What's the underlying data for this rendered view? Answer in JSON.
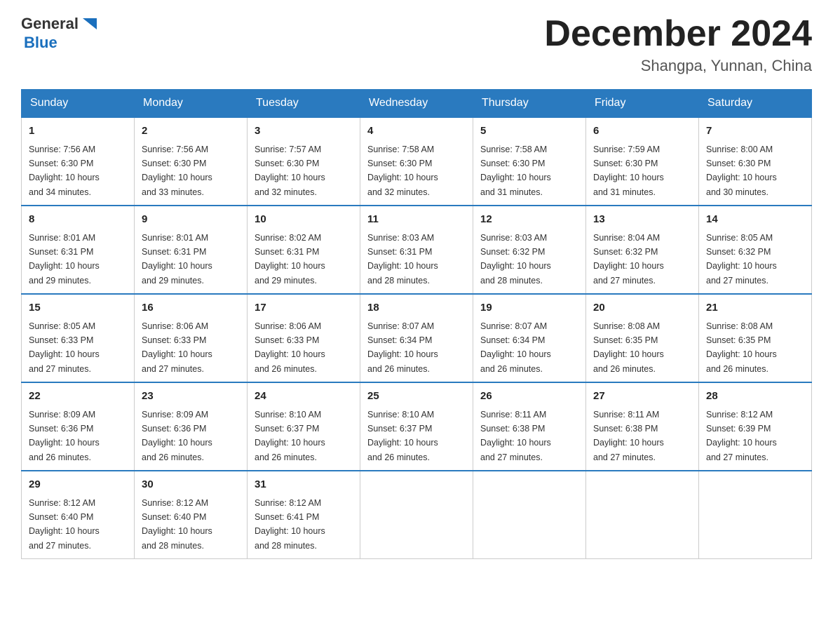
{
  "header": {
    "logo_general": "General",
    "logo_blue": "Blue",
    "title": "December 2024",
    "location": "Shangpa, Yunnan, China"
  },
  "columns": [
    "Sunday",
    "Monday",
    "Tuesday",
    "Wednesday",
    "Thursday",
    "Friday",
    "Saturday"
  ],
  "weeks": [
    [
      {
        "day": "1",
        "info": "Sunrise: 7:56 AM\nSunset: 6:30 PM\nDaylight: 10 hours\nand 34 minutes."
      },
      {
        "day": "2",
        "info": "Sunrise: 7:56 AM\nSunset: 6:30 PM\nDaylight: 10 hours\nand 33 minutes."
      },
      {
        "day": "3",
        "info": "Sunrise: 7:57 AM\nSunset: 6:30 PM\nDaylight: 10 hours\nand 32 minutes."
      },
      {
        "day": "4",
        "info": "Sunrise: 7:58 AM\nSunset: 6:30 PM\nDaylight: 10 hours\nand 32 minutes."
      },
      {
        "day": "5",
        "info": "Sunrise: 7:58 AM\nSunset: 6:30 PM\nDaylight: 10 hours\nand 31 minutes."
      },
      {
        "day": "6",
        "info": "Sunrise: 7:59 AM\nSunset: 6:30 PM\nDaylight: 10 hours\nand 31 minutes."
      },
      {
        "day": "7",
        "info": "Sunrise: 8:00 AM\nSunset: 6:30 PM\nDaylight: 10 hours\nand 30 minutes."
      }
    ],
    [
      {
        "day": "8",
        "info": "Sunrise: 8:01 AM\nSunset: 6:31 PM\nDaylight: 10 hours\nand 29 minutes."
      },
      {
        "day": "9",
        "info": "Sunrise: 8:01 AM\nSunset: 6:31 PM\nDaylight: 10 hours\nand 29 minutes."
      },
      {
        "day": "10",
        "info": "Sunrise: 8:02 AM\nSunset: 6:31 PM\nDaylight: 10 hours\nand 29 minutes."
      },
      {
        "day": "11",
        "info": "Sunrise: 8:03 AM\nSunset: 6:31 PM\nDaylight: 10 hours\nand 28 minutes."
      },
      {
        "day": "12",
        "info": "Sunrise: 8:03 AM\nSunset: 6:32 PM\nDaylight: 10 hours\nand 28 minutes."
      },
      {
        "day": "13",
        "info": "Sunrise: 8:04 AM\nSunset: 6:32 PM\nDaylight: 10 hours\nand 27 minutes."
      },
      {
        "day": "14",
        "info": "Sunrise: 8:05 AM\nSunset: 6:32 PM\nDaylight: 10 hours\nand 27 minutes."
      }
    ],
    [
      {
        "day": "15",
        "info": "Sunrise: 8:05 AM\nSunset: 6:33 PM\nDaylight: 10 hours\nand 27 minutes."
      },
      {
        "day": "16",
        "info": "Sunrise: 8:06 AM\nSunset: 6:33 PM\nDaylight: 10 hours\nand 27 minutes."
      },
      {
        "day": "17",
        "info": "Sunrise: 8:06 AM\nSunset: 6:33 PM\nDaylight: 10 hours\nand 26 minutes."
      },
      {
        "day": "18",
        "info": "Sunrise: 8:07 AM\nSunset: 6:34 PM\nDaylight: 10 hours\nand 26 minutes."
      },
      {
        "day": "19",
        "info": "Sunrise: 8:07 AM\nSunset: 6:34 PM\nDaylight: 10 hours\nand 26 minutes."
      },
      {
        "day": "20",
        "info": "Sunrise: 8:08 AM\nSunset: 6:35 PM\nDaylight: 10 hours\nand 26 minutes."
      },
      {
        "day": "21",
        "info": "Sunrise: 8:08 AM\nSunset: 6:35 PM\nDaylight: 10 hours\nand 26 minutes."
      }
    ],
    [
      {
        "day": "22",
        "info": "Sunrise: 8:09 AM\nSunset: 6:36 PM\nDaylight: 10 hours\nand 26 minutes."
      },
      {
        "day": "23",
        "info": "Sunrise: 8:09 AM\nSunset: 6:36 PM\nDaylight: 10 hours\nand 26 minutes."
      },
      {
        "day": "24",
        "info": "Sunrise: 8:10 AM\nSunset: 6:37 PM\nDaylight: 10 hours\nand 26 minutes."
      },
      {
        "day": "25",
        "info": "Sunrise: 8:10 AM\nSunset: 6:37 PM\nDaylight: 10 hours\nand 26 minutes."
      },
      {
        "day": "26",
        "info": "Sunrise: 8:11 AM\nSunset: 6:38 PM\nDaylight: 10 hours\nand 27 minutes."
      },
      {
        "day": "27",
        "info": "Sunrise: 8:11 AM\nSunset: 6:38 PM\nDaylight: 10 hours\nand 27 minutes."
      },
      {
        "day": "28",
        "info": "Sunrise: 8:12 AM\nSunset: 6:39 PM\nDaylight: 10 hours\nand 27 minutes."
      }
    ],
    [
      {
        "day": "29",
        "info": "Sunrise: 8:12 AM\nSunset: 6:40 PM\nDaylight: 10 hours\nand 27 minutes."
      },
      {
        "day": "30",
        "info": "Sunrise: 8:12 AM\nSunset: 6:40 PM\nDaylight: 10 hours\nand 28 minutes."
      },
      {
        "day": "31",
        "info": "Sunrise: 8:12 AM\nSunset: 6:41 PM\nDaylight: 10 hours\nand 28 minutes."
      },
      null,
      null,
      null,
      null
    ]
  ]
}
